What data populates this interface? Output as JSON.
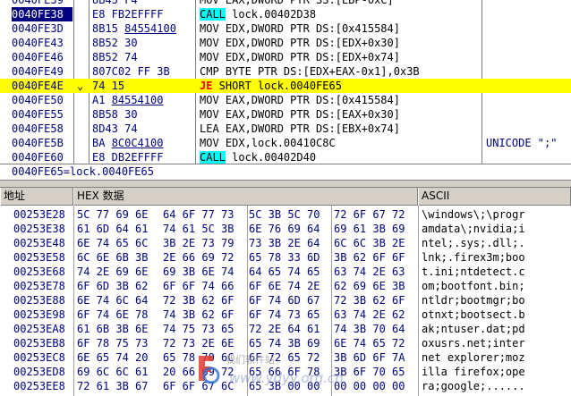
{
  "disasm": {
    "rows": [
      {
        "addr": "0040FE39",
        "hex": "8B45 F4",
        "asm": "MOV EAX,DWORD PTR SS:[EBP-0xC]",
        "partial": true
      },
      {
        "addr": "0040FE38",
        "hex": "E8 FB2EFFFF",
        "kw": "CALL",
        "asm": " lock.00402D38",
        "cur": true
      },
      {
        "addr": "0040FE3D",
        "hex_pre": "8B15 ",
        "hex_u": "84554100",
        "asm": "MOV EDX,DWORD PTR DS:[0x415584]"
      },
      {
        "addr": "0040FE43",
        "hex": "8B52 30",
        "asm": "MOV EDX,DWORD PTR DS:[EDX+0x30]"
      },
      {
        "addr": "0040FE46",
        "hex": "8B52 74",
        "asm": "MOV EDX,DWORD PTR DS:[EDX+0x74]"
      },
      {
        "addr": "0040FE49",
        "hex": "807C02 FF 3B",
        "asm": "CMP BYTE PTR DS:[EDX+EAX-0x1],0x3B"
      },
      {
        "addr": "0040FE4E",
        "mark": "⌄",
        "hex": "74 15",
        "jmp": "JE",
        "asm": " SHORT lock.0040FE65",
        "sel": true
      },
      {
        "addr": "0040FE50",
        "hex_pre": "A1 ",
        "hex_u": "84554100",
        "asm": "MOV EAX,DWORD PTR DS:[0x415584]"
      },
      {
        "addr": "0040FE55",
        "hex": "8B58 30",
        "asm": "MOV EAX,DWORD PTR DS:[EAX+0x30]"
      },
      {
        "addr": "0040FE58",
        "hex": "8D43 74",
        "asm": "LEA EAX,DWORD PTR DS:[EBX+0x74]"
      },
      {
        "addr": "0040FE5B",
        "hex_pre": "BA ",
        "hex_u": "8C0C4100",
        "asm": "MOV EDX,lock.00410C8C",
        "cmt": "UNICODE \";\""
      },
      {
        "addr": "0040FE60",
        "hex": "E8 DB2EFFFF",
        "kw": "CALL",
        "asm": " lock.00402D40"
      }
    ]
  },
  "info_line": "0040FE65=lock.0040FE65",
  "dump": {
    "headers": {
      "address": "地址",
      "hex": "HEX 数据",
      "ascii": "ASCII"
    },
    "rows": [
      {
        "addr": "00253E28",
        "b": [
          "5C 77 69 6E",
          "64 6F 77 73",
          "5C 3B 5C 70",
          "72 6F 67 72"
        ],
        "ascii": "\\windows\\;\\progr"
      },
      {
        "addr": "00253E38",
        "b": [
          "61 6D 64 61",
          "74 61 5C 3B",
          "6E 76 69 64",
          "69 61 3B 69"
        ],
        "ascii": "amdata\\;nvidia;i"
      },
      {
        "addr": "00253E48",
        "b": [
          "6E 74 65 6C",
          "3B 2E 73 79",
          "73 3B 2E 64",
          "6C 6C 3B 2E"
        ],
        "ascii": "ntel;.sys;.dll;."
      },
      {
        "addr": "00253E58",
        "b": [
          "6C 6E 6B 3B",
          "2E 66 69 72",
          "65 78 33 6D",
          "3B 62 6F 6F"
        ],
        "ascii": "lnk;.firex3m;boo"
      },
      {
        "addr": "00253E68",
        "b": [
          "74 2E 69 6E",
          "69 3B 6E 74",
          "64 65 74 65",
          "63 74 2E 63"
        ],
        "ascii": "t.ini;ntdetect.c"
      },
      {
        "addr": "00253E78",
        "b": [
          "6F 6D 3B 62",
          "6F 6F 74 66",
          "6F 6E 74 2E",
          "62 69 6E 3B"
        ],
        "ascii": "om;bootfont.bin;"
      },
      {
        "addr": "00253E88",
        "b": [
          "6E 74 6C 64",
          "72 3B 62 6F",
          "6F 74 6D 67",
          "72 3B 62 6F"
        ],
        "ascii": "ntldr;bootmgr;bo"
      },
      {
        "addr": "00253E98",
        "b": [
          "6F 74 6E 78",
          "74 3B 62 6F",
          "6F 74 73 65",
          "63 74 2E 62"
        ],
        "ascii": "otnxt;bootsect.b"
      },
      {
        "addr": "00253EA8",
        "b": [
          "61 6B 3B 6E",
          "74 75 73 65",
          "72 2E 64 61",
          "74 3B 70 64"
        ],
        "ascii": "ak;ntuser.dat;pd"
      },
      {
        "addr": "00253EB8",
        "b": [
          "6F 78 75 73",
          "72 73 2E 6E",
          "65 74 3B 69",
          "6E 74 65 72"
        ],
        "ascii": "oxusrs.net;inter"
      },
      {
        "addr": "00253EC8",
        "b": [
          "6E 65 74 20",
          "65 78 70 6C",
          "6F 72 65 72",
          "3B 6D 6F 7A"
        ],
        "ascii": "net explorer;moz"
      },
      {
        "addr": "00253ED8",
        "b": [
          "69 6C 6C 61",
          "20 66 69 72",
          "65 66 6F 78",
          "3B 6F 70 65"
        ],
        "ascii": "illa firefox;ope"
      },
      {
        "addr": "00253EE8",
        "b": [
          "72 61 3B 67",
          "6F 6F 67 6C",
          "65 3B 00 00",
          "00 00 00 00"
        ],
        "ascii": "ra;google;......"
      }
    ]
  },
  "watermark": {
    "line1": "我们软件站",
    "line2": "www.ydyy.org.cn"
  }
}
